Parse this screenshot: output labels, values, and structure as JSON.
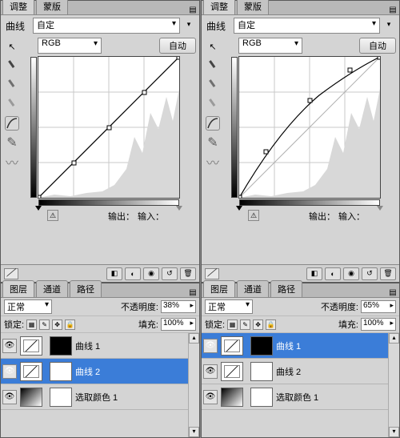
{
  "panels": {
    "left": {
      "adjustments": {
        "tabs": {
          "adjust": "调整",
          "mask": "蒙版"
        },
        "preset_label": "曲线",
        "preset_value": "自定",
        "channel": "RGB",
        "auto": "自动",
        "output_label": "输出：",
        "input_label": "输入："
      },
      "layers": {
        "tabs": {
          "layers": "图层",
          "channels": "通道",
          "paths": "路径"
        },
        "blend": "正常",
        "opacity_label": "不透明度:",
        "opacity_value": "38%",
        "lock_label": "锁定:",
        "fill_label": "填充:",
        "fill_value": "100%",
        "items": [
          {
            "name": "曲线 1",
            "mask": "black",
            "selected": false
          },
          {
            "name": "曲线 2",
            "mask": "white",
            "selected": true
          },
          {
            "name": "选取颜色 1",
            "mask": "white",
            "thumb": "grad",
            "selected": false
          }
        ]
      }
    },
    "right": {
      "adjustments": {
        "tabs": {
          "adjust": "调整",
          "mask": "蒙版"
        },
        "preset_label": "曲线",
        "preset_value": "自定",
        "channel": "RGB",
        "auto": "自动",
        "output_label": "输出：",
        "input_label": "输入："
      },
      "layers": {
        "tabs": {
          "layers": "图层",
          "channels": "通道",
          "paths": "路径"
        },
        "blend": "正常",
        "opacity_label": "不透明度:",
        "opacity_value": "65%",
        "lock_label": "锁定:",
        "fill_label": "填充:",
        "fill_value": "100%",
        "items": [
          {
            "name": "曲线 1",
            "mask": "black",
            "selected": true
          },
          {
            "name": "曲线 2",
            "mask": "white",
            "selected": false
          },
          {
            "name": "选取颜色 1",
            "mask": "white",
            "thumb": "grad",
            "selected": false
          }
        ]
      }
    }
  },
  "chart_data": [
    {
      "type": "line",
      "title": "Curves (left)",
      "xlabel": "Input",
      "ylabel": "Output",
      "xlim": [
        0,
        255
      ],
      "ylim": [
        0,
        255
      ],
      "series": [
        {
          "name": "RGB",
          "values": [
            [
              0,
              0
            ],
            [
              64,
              64
            ],
            [
              128,
              128
            ],
            [
              192,
              192
            ],
            [
              255,
              255
            ]
          ]
        }
      ]
    },
    {
      "type": "line",
      "title": "Curves (right)",
      "xlabel": "Input",
      "ylabel": "Output",
      "xlim": [
        0,
        255
      ],
      "ylim": [
        0,
        255
      ],
      "series": [
        {
          "name": "RGB",
          "values": [
            [
              0,
              0
            ],
            [
              48,
              84
            ],
            [
              128,
              178
            ],
            [
              200,
              232
            ],
            [
              255,
              255
            ]
          ]
        }
      ]
    }
  ]
}
